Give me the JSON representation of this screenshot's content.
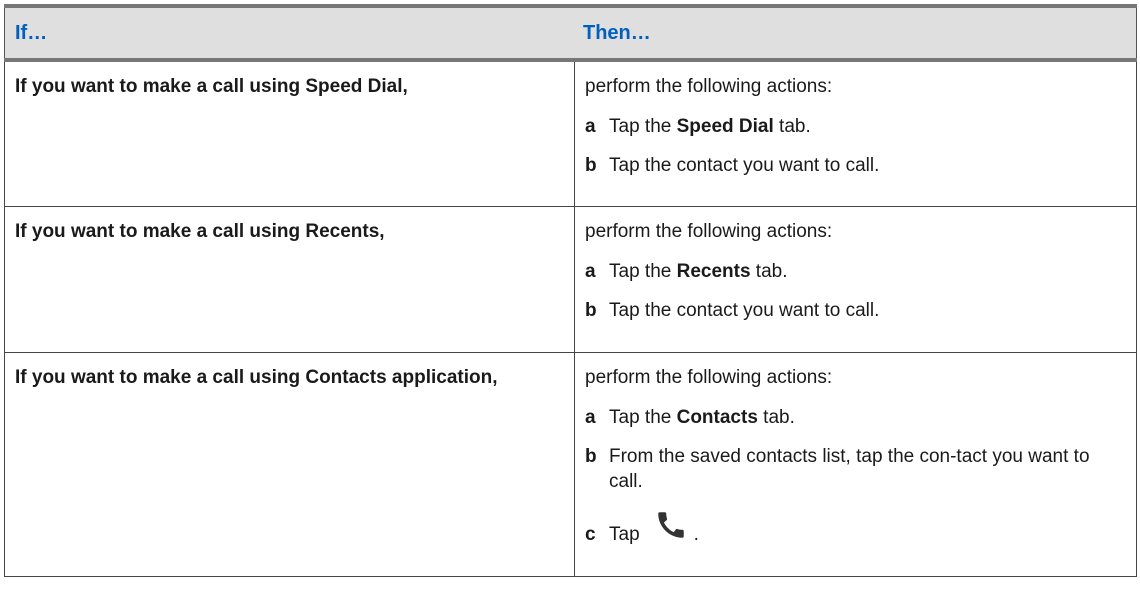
{
  "table": {
    "header": {
      "col1": "If…",
      "col2": "Then…"
    },
    "rows": [
      {
        "condition": "If you want to make a call using Speed Dial,",
        "intro": "perform the following actions:",
        "steps": [
          {
            "label": "a",
            "pre": "Tap the ",
            "bold": "Speed Dial",
            "post": " tab."
          },
          {
            "label": "b",
            "text": "Tap the contact you want to call."
          }
        ]
      },
      {
        "condition": "If you want to make a call using Recents,",
        "intro": "perform the following actions:",
        "steps": [
          {
            "label": "a",
            "pre": "Tap the ",
            "bold": "Recents",
            "post": " tab."
          },
          {
            "label": "b",
            "text": "Tap the contact you want to call."
          }
        ]
      },
      {
        "condition": "If you want to make a call using Contacts application,",
        "intro": "perform the following actions:",
        "steps": [
          {
            "label": "a",
            "pre": "Tap the ",
            "bold": "Contacts",
            "post": " tab."
          },
          {
            "label": "b",
            "text": "From the saved contacts list, tap the con-tact you want to call."
          },
          {
            "label": "c",
            "pre": "Tap",
            "icon": "phone-icon",
            "post": "."
          }
        ]
      }
    ]
  },
  "colors": {
    "header_text": "#0060bf",
    "header_bg": "#dfdfdf",
    "rule": "#777777",
    "icon": "#333333"
  }
}
